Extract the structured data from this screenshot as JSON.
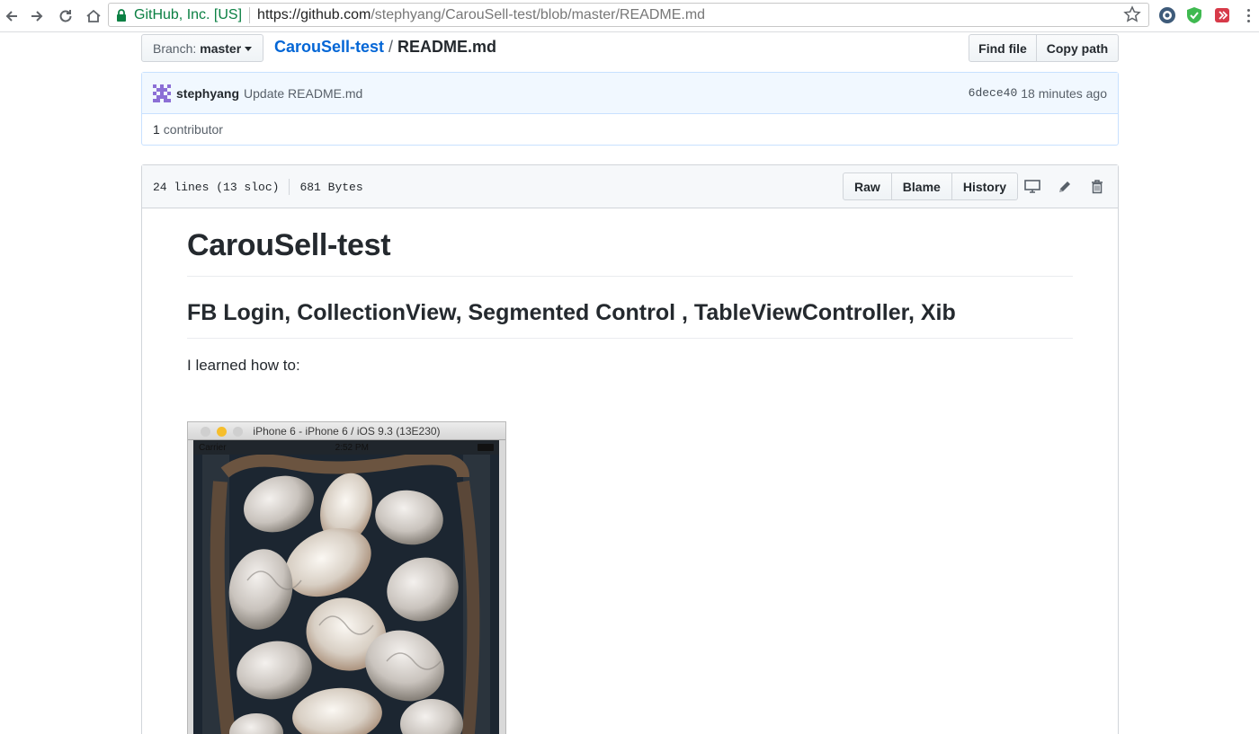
{
  "browser": {
    "security_org": "GitHub, Inc. [US]",
    "url_host": "https://github.com",
    "url_path": "/stephyang/CarouSell-test/blob/master/README.md"
  },
  "repo_header": {
    "branch_label": "Branch:",
    "branch_name": "master",
    "repo_name": "CarouSell-test",
    "separator": "/",
    "file_name": "README.md",
    "find_file": "Find file",
    "copy_path": "Copy path"
  },
  "commit": {
    "author": "stephyang",
    "message": "Update README.md",
    "sha": "6dece40",
    "time_ago": "18 minutes ago",
    "contributors_count": "1",
    "contributors_label": "contributor"
  },
  "file": {
    "lines": "24 lines (13 sloc)",
    "size": "681 Bytes",
    "raw": "Raw",
    "blame": "Blame",
    "history": "History"
  },
  "readme": {
    "h1": "CarouSell-test",
    "h2": "FB Login, CollectionView, Segmented Control , TableViewController, Xib",
    "paragraph": "I learned how to:"
  },
  "simulator": {
    "title": "iPhone 6 - iPhone 6 / iOS 9.3 (13E230)",
    "carrier": "Carrier",
    "time": "2:52 PM"
  },
  "colors": {
    "link": "#0366d6",
    "secure_green": "#0b8043",
    "commit_bg": "#f1f8ff"
  }
}
